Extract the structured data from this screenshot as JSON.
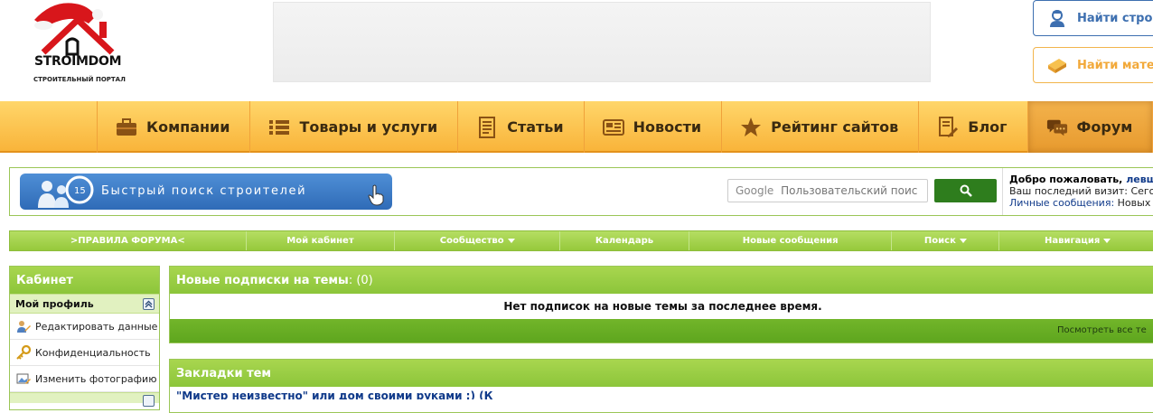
{
  "logo": {
    "text": "STROIMDOM",
    "sub": "СТРОИТЕЛЬНЫЙ ПОРТАЛ"
  },
  "side_buttons": {
    "find_builders": "Найти стро",
    "find_materials": "Найти мате"
  },
  "main_nav": [
    {
      "label": "Компании",
      "icon": "briefcase-icon"
    },
    {
      "label": "Товары и услуги",
      "icon": "list-icon"
    },
    {
      "label": "Статьи",
      "icon": "article-icon"
    },
    {
      "label": "Новости",
      "icon": "newspaper-icon"
    },
    {
      "label": "Рейтинг сайтов",
      "icon": "star-icon"
    },
    {
      "label": "Блог",
      "icon": "blog-icon"
    },
    {
      "label": "Форум",
      "icon": "chat-icon",
      "active": true
    }
  ],
  "quick_search": {
    "label": "Быстрый поиск строителей",
    "calendar_day": "15"
  },
  "google_search": {
    "brand": "Google",
    "placeholder": "Пользовательский поис"
  },
  "welcome": {
    "greeting": "Добро пожаловать,",
    "user": "левш",
    "last_visit": "Ваш последний визит: Сего",
    "messages_label": "Личные сообщения:",
    "messages_value": "Новых"
  },
  "forum_nav": [
    {
      "label": ">ПРАВИЛА ФОРУМА<",
      "dropdown": false
    },
    {
      "label": "Мой кабинет",
      "dropdown": false
    },
    {
      "label": "Сообщество",
      "dropdown": true
    },
    {
      "label": "Календарь",
      "dropdown": false
    },
    {
      "label": "Новые сообщения",
      "dropdown": false
    },
    {
      "label": "Поиск",
      "dropdown": true
    },
    {
      "label": "Навигация",
      "dropdown": true
    }
  ],
  "sidebar": {
    "title": "Кабинет",
    "section": "Мой профиль",
    "items": [
      {
        "label": "Редактировать данные",
        "icon": "edit-profile-icon"
      },
      {
        "label": "Конфиденциальность",
        "icon": "key-icon"
      },
      {
        "label": "Изменить фотографию",
        "icon": "photo-icon"
      }
    ]
  },
  "subscriptions": {
    "title": "Новые подписки на темы",
    "count": ": (0)",
    "empty_message": "Нет подписок на новые темы за последнее время.",
    "view_all": "Посмотреть все те"
  },
  "bookmarks": {
    "title": "Закладки тем",
    "first_row": "\"Мистер неизвестно\" или дом своими руками :) (К"
  },
  "colors": {
    "orange_nav": "#f9b43a",
    "green": "#96c93b",
    "dark_green": "#5ea61e",
    "link": "#103a8a"
  }
}
